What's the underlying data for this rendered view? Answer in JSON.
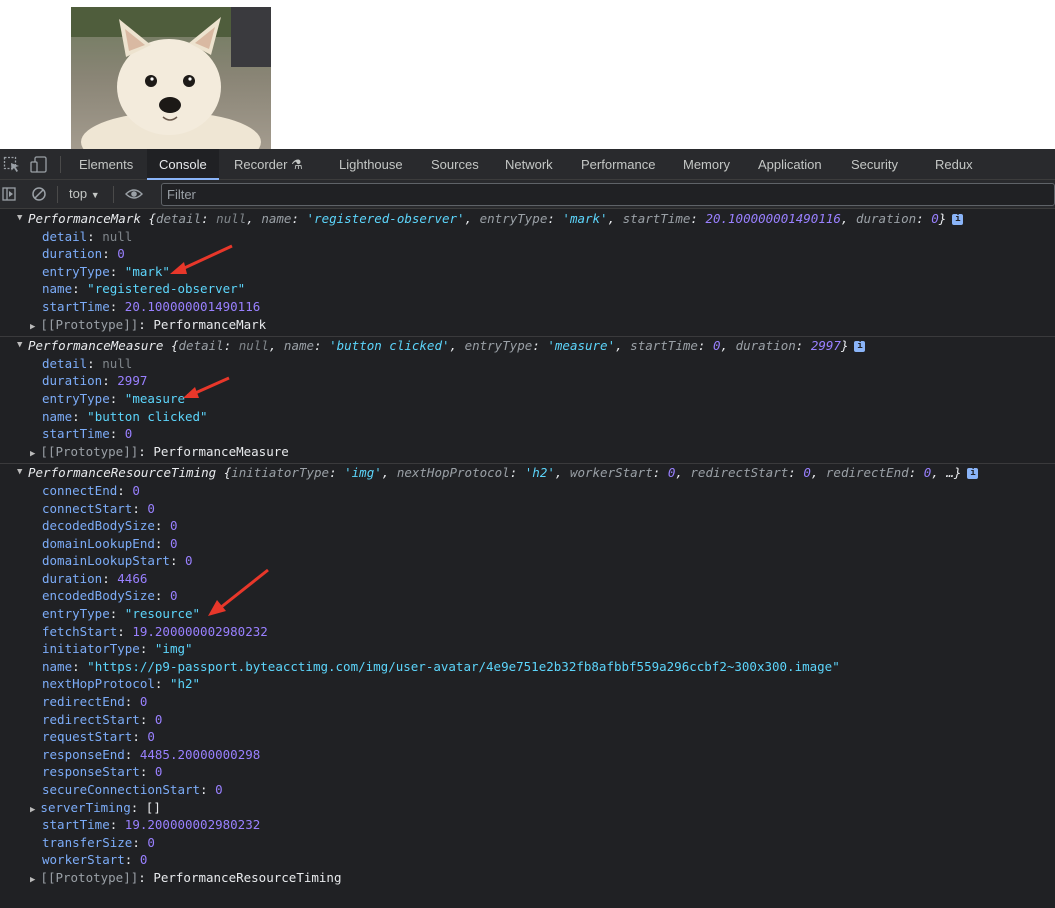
{
  "page": {
    "image_alt": "dog"
  },
  "devtools": {
    "tabs": [
      "Elements",
      "Console",
      "Recorder",
      "Lighthouse",
      "Sources",
      "Network",
      "Performance",
      "Memory",
      "Application",
      "Security",
      "Redux"
    ],
    "active_tab": "Console",
    "toolbar": {
      "context": "top",
      "filter_placeholder": "Filter"
    }
  },
  "console": {
    "entries": [
      {
        "summary_class": "PerformanceMark",
        "summary_body": "{detail: null, name: 'registered-observer', entryType: 'mark', startTime: 20.100000001490116, duration: 0}",
        "props": [
          {
            "key": "detail",
            "value": "null"
          },
          {
            "key": "duration",
            "value": "0"
          },
          {
            "key": "entryType",
            "value": "\"mark\""
          },
          {
            "key": "name",
            "value": "\"registered-observer\""
          },
          {
            "key": "startTime",
            "value": "20.100000001490116"
          }
        ],
        "prototype": "PerformanceMark"
      },
      {
        "summary_class": "PerformanceMeasure",
        "summary_body": "{detail: null, name: 'button clicked', entryType: 'measure', startTime: 0, duration: 2997}",
        "props": [
          {
            "key": "detail",
            "value": "null"
          },
          {
            "key": "duration",
            "value": "2997"
          },
          {
            "key": "entryType",
            "value": "\"measure\""
          },
          {
            "key": "name",
            "value": "\"button clicked\""
          },
          {
            "key": "startTime",
            "value": "0"
          }
        ],
        "prototype": "PerformanceMeasure"
      },
      {
        "summary_class": "PerformanceResourceTiming",
        "summary_body": "{initiatorType: 'img', nextHopProtocol: 'h2', workerStart: 0, redirectStart: 0, redirectEnd: 0, …}",
        "props": [
          {
            "key": "connectEnd",
            "value": "0"
          },
          {
            "key": "connectStart",
            "value": "0"
          },
          {
            "key": "decodedBodySize",
            "value": "0"
          },
          {
            "key": "domainLookupEnd",
            "value": "0"
          },
          {
            "key": "domainLookupStart",
            "value": "0"
          },
          {
            "key": "duration",
            "value": "4466"
          },
          {
            "key": "encodedBodySize",
            "value": "0"
          },
          {
            "key": "entryType",
            "value": "\"resource\""
          },
          {
            "key": "fetchStart",
            "value": "19.200000002980232"
          },
          {
            "key": "initiatorType",
            "value": "\"img\""
          },
          {
            "key": "name",
            "value": "\"https://p9-passport.byteacctimg.com/img/user-avatar/4e9e751e2b32fb8afbbf559a296ccbf2~300x300.image\""
          },
          {
            "key": "nextHopProtocol",
            "value": "\"h2\""
          },
          {
            "key": "redirectEnd",
            "value": "0"
          },
          {
            "key": "redirectStart",
            "value": "0"
          },
          {
            "key": "requestStart",
            "value": "0"
          },
          {
            "key": "responseEnd",
            "value": "4485.20000000298"
          },
          {
            "key": "responseStart",
            "value": "0"
          },
          {
            "key": "secureConnectionStart",
            "value": "0"
          },
          {
            "key": "serverTiming",
            "value": "[]"
          },
          {
            "key": "startTime",
            "value": "19.200000002980232"
          },
          {
            "key": "transferSize",
            "value": "0"
          },
          {
            "key": "workerStart",
            "value": "0"
          }
        ],
        "prototype": "PerformanceResourceTiming"
      }
    ],
    "prototype_key": "[[Prototype]]"
  },
  "colors": {
    "annotation_arrow": "#e8372a",
    "string": "#5cd5fb",
    "number": "#9980ff",
    "key": "#7cacf8"
  }
}
